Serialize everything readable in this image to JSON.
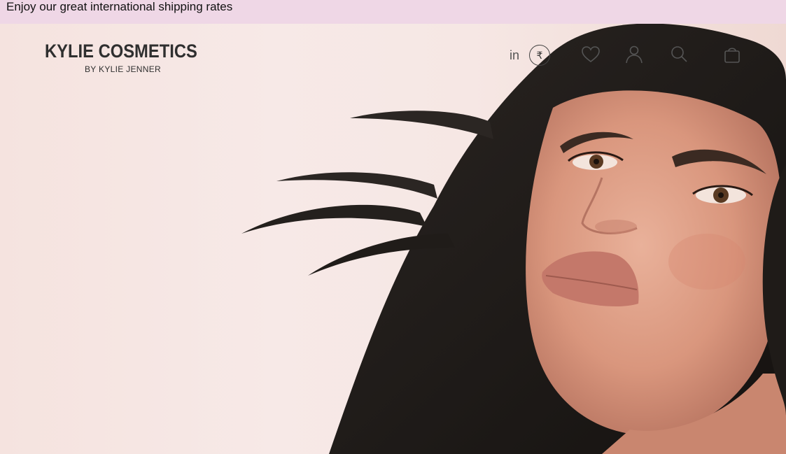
{
  "promo": {
    "text": "Enjoy our great international shipping rates"
  },
  "brand": {
    "name": "KYLIE COSMETICS",
    "tagline": "BY KYLIE JENNER"
  },
  "header": {
    "locale_label": "in",
    "currency_symbol": "₹",
    "icons": [
      "heart-icon",
      "user-icon",
      "search-icon",
      "bag-icon"
    ]
  },
  "colors": {
    "promo_bg": "#efd7e6",
    "hero_bg": "#f4e6e3",
    "logo_text": "#2f2f2f",
    "icon_stroke": "#555555"
  }
}
